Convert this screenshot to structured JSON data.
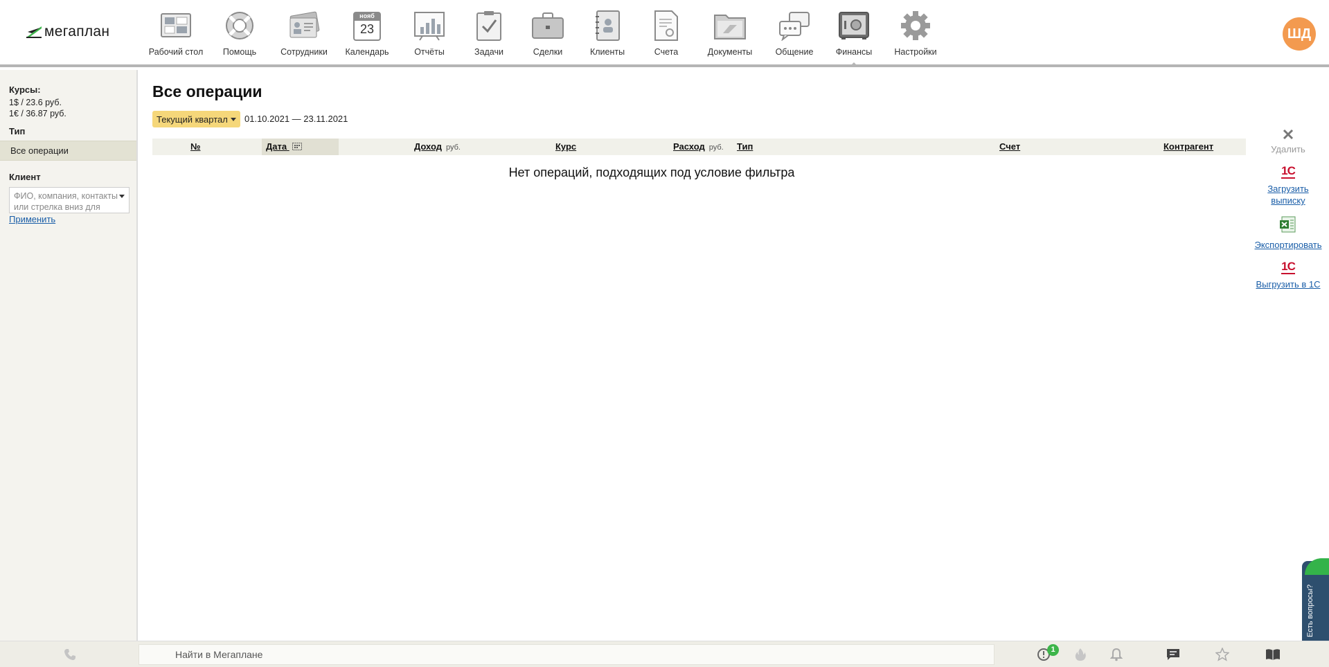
{
  "app": {
    "logo_text": "мегаплан"
  },
  "nav": {
    "items": [
      {
        "label": "Рабочий стол",
        "icon": "desktop-icon"
      },
      {
        "label": "Помощь",
        "icon": "lifebuoy-icon"
      },
      {
        "label": "Сотрудники",
        "icon": "employees-icon"
      },
      {
        "label": "Календарь",
        "icon": "calendar-icon",
        "cal_month": "нояб",
        "cal_day": "23"
      },
      {
        "label": "Отчёты",
        "icon": "reports-icon"
      },
      {
        "label": "Задачи",
        "icon": "tasks-icon"
      },
      {
        "label": "Сделки",
        "icon": "briefcase-icon"
      },
      {
        "label": "Клиенты",
        "icon": "clients-icon"
      },
      {
        "label": "Счета",
        "icon": "invoice-icon"
      },
      {
        "label": "Документы",
        "icon": "documents-icon"
      },
      {
        "label": "Общение",
        "icon": "chat-icon"
      },
      {
        "label": "Финансы",
        "icon": "safe-icon",
        "active": true
      },
      {
        "label": "Настройки",
        "icon": "gear-icon"
      }
    ]
  },
  "user": {
    "initials": "ШД",
    "avatar_color": "#f39a4f"
  },
  "sidebar": {
    "rates_title": "Курсы:",
    "rate_usd": "1$ / 23.6 руб.",
    "rate_eur": "1€ / 36.87 руб.",
    "type_title": "Тип",
    "type_selected": "Все операции",
    "client_title": "Клиент",
    "client_placeholder": "ФИО, компания, контакты или стрелка вниз для",
    "apply_label": "Применить"
  },
  "main": {
    "title": "Все операции",
    "period_label": "Текущий квартал",
    "period_range": "01.10.2021 — 23.11.2021",
    "columns": {
      "num": "№",
      "date": "Дата",
      "income": "Доход",
      "income_unit": "руб.",
      "rate": "Курс",
      "expense": "Расход",
      "expense_unit": "руб.",
      "type": "Тип",
      "account": "Счет",
      "contractor": "Контрагент"
    },
    "empty_message": "Нет операций, подходящих под условие фильтра"
  },
  "actions": {
    "delete": "Удалить",
    "load_statement_1": "Загрузить",
    "load_statement_2": "выписку",
    "export": "Экспортировать",
    "export_1c": "Выгрузить в 1С",
    "onec_logo": "1С"
  },
  "help_tab": {
    "label": "Есть вопросы?"
  },
  "bottombar": {
    "search_placeholder": "Найти в Мегаплане",
    "notifications_count": "1"
  },
  "colors": {
    "accent_yellow": "#f5d77a",
    "link_blue": "#1a5ea8",
    "badge_green": "#3db54a",
    "help_tab_blue": "#2e4f6e"
  }
}
